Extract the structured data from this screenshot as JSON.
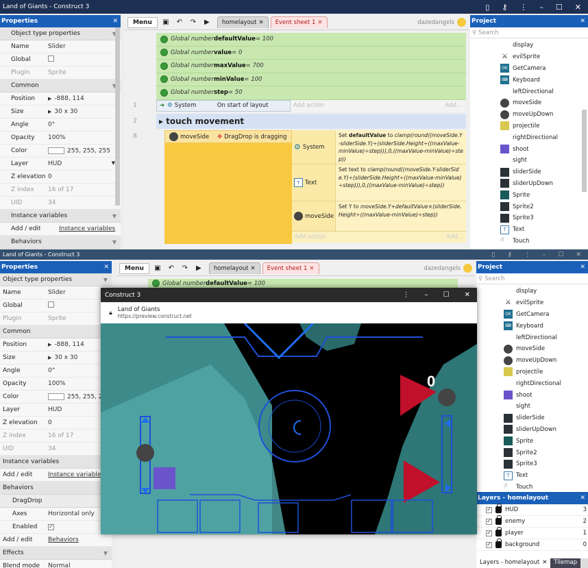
{
  "top": {
    "title": "Land of Giants - Construct 3",
    "properties": {
      "header": "Properties",
      "section": "Object type properties",
      "rows": [
        {
          "n": "Name",
          "v": "Slider"
        },
        {
          "n": "Global",
          "v": ""
        },
        {
          "n": "Plugin",
          "v": "Sprite"
        }
      ],
      "common": "Common",
      "rows2": [
        {
          "n": "Position",
          "v": "-888, 114"
        },
        {
          "n": "Size",
          "v": "30 x 30"
        },
        {
          "n": "Angle",
          "v": "0°"
        },
        {
          "n": "Opacity",
          "v": "100%"
        },
        {
          "n": "Color",
          "v": "255, 255, 255"
        },
        {
          "n": "Layer",
          "v": "HUD"
        },
        {
          "n": "Z elevation",
          "v": "0"
        },
        {
          "n": "Z index",
          "v": "16 of 17"
        },
        {
          "n": "UID",
          "v": "34"
        }
      ],
      "instvars": "Instance variables",
      "addedit": "Add / edit",
      "instlink": "Instance variables",
      "behaviors": "Behaviors"
    },
    "toolbar": {
      "menu": "Menu",
      "tab1": "homelayout",
      "tab2": "Event sheet 1",
      "user": "dazedangels"
    },
    "gvars": [
      {
        "pre": "Global number ",
        "name": "defaultValue",
        "post": " = 100"
      },
      {
        "pre": "Global number ",
        "name": "value",
        "post": " = 0"
      },
      {
        "pre": "Global number ",
        "name": "maxValue",
        "post": " = 700"
      },
      {
        "pre": "Global number ",
        "name": "minValue",
        "post": " = 100"
      },
      {
        "pre": "Global number ",
        "name": "step",
        "post": " = 50"
      }
    ],
    "ev1": {
      "num": "1",
      "obj": "System",
      "cond": "On start of layout",
      "add": "Add action",
      "addr": "Add..."
    },
    "ev2": {
      "num": "2",
      "title": "touch movement"
    },
    "ev3": {
      "num": "8",
      "obj": "moveSide",
      "cond": "DragDrop is dragging",
      "add": "Add action",
      "addr": "Add...",
      "actions": [
        {
          "obj": "System",
          "pre": "Set ",
          "b": "defaultValue",
          "mid": " to ",
          "it": "clamp(round((moveSide.Y-sliderSide.Y)÷(sliderSide.Height÷((maxValue-minValue)÷step))),0,((maxValue-minValue)÷step))"
        },
        {
          "obj": "Text",
          "pre": "Set text to ",
          "b": "",
          "mid": "",
          "it": "clamp(round((moveSide.Y-sliderSide.Y)÷(sliderSide.Height÷((maxValue-minValue)÷step))),0,((maxValue-minValue)÷step))"
        },
        {
          "obj": "moveSide",
          "pre": "Set Y to ",
          "b": "",
          "mid": "",
          "it": "moveSide.Y+defaultValue×(sliderSide.Height÷((maxValue-minValue)÷step))"
        }
      ]
    },
    "project": {
      "header": "Project",
      "search": "Search",
      "items": [
        "display",
        "evilSprite",
        "GetCamera",
        "Keyboard",
        "leftDirectional",
        "moveSide",
        "moveUpDown",
        "projectile",
        "rightDirectional",
        "shoot",
        "sight",
        "sliderSide",
        "sliderUpDown",
        "Sprite",
        "Sprite2",
        "Sprite3",
        "Text",
        "Touch"
      ]
    }
  },
  "bottom": {
    "title": "Land of Giants - Construct 3",
    "properties": {
      "header": "Properties",
      "section": "Object type properties",
      "rows": [
        {
          "n": "Name",
          "v": "Slider"
        },
        {
          "n": "Global",
          "v": ""
        },
        {
          "n": "Plugin",
          "v": "Sprite"
        }
      ],
      "common": "Common",
      "rows2": [
        {
          "n": "Position",
          "v": "-888, 114"
        },
        {
          "n": "Size",
          "v": "30 x 30"
        },
        {
          "n": "Angle",
          "v": "0°"
        },
        {
          "n": "Opacity",
          "v": "100%"
        },
        {
          "n": "Color",
          "v": "255, 255, 255"
        },
        {
          "n": "Layer",
          "v": "HUD"
        },
        {
          "n": "Z elevation",
          "v": "0"
        },
        {
          "n": "Z index",
          "v": "16 of 17"
        },
        {
          "n": "UID",
          "v": "34"
        }
      ],
      "instvars": "Instance variables",
      "addedit": "Add / edit",
      "instlink": "Instance variables",
      "behaviors": "Behaviors",
      "dragdrop": "DragDrop",
      "axes": "Axes",
      "axesval": "Horizontal only",
      "enabled": "Enabled",
      "behlink": "Behaviors",
      "effects": "Effects",
      "blend": "Blend mode",
      "blendval": "Normal"
    },
    "toolbar": {
      "menu": "Menu",
      "tab1": "homelayout",
      "tab2": "Event sheet 1",
      "user": "dazedangels"
    },
    "gvar": {
      "pre": "Global number ",
      "name": "defaultValue",
      "post": " = 100"
    },
    "project": {
      "header": "Project",
      "search": "Search",
      "items": [
        "display",
        "evilSprite",
        "GetCamera",
        "Keyboard",
        "leftDirectional",
        "moveSide",
        "moveUpDown",
        "projectile",
        "rightDirectional",
        "shoot",
        "sight",
        "sliderSide",
        "sliderUpDown",
        "Sprite",
        "Sprite2",
        "Sprite3",
        "Text",
        "Touch"
      ]
    },
    "layers": {
      "header": "Layers - homelayout",
      "rows": [
        {
          "name": "HUD",
          "n": "3"
        },
        {
          "name": "enemy",
          "n": "2"
        },
        {
          "name": "player",
          "n": "1"
        },
        {
          "name": "background",
          "n": "0"
        }
      ],
      "tab1": "Layers - homelayout",
      "tab2": "Tilemap"
    },
    "preview": {
      "title": "Construct 3",
      "site": "Land of Giants",
      "url": "https://preview.construct.net",
      "score": "0"
    }
  }
}
